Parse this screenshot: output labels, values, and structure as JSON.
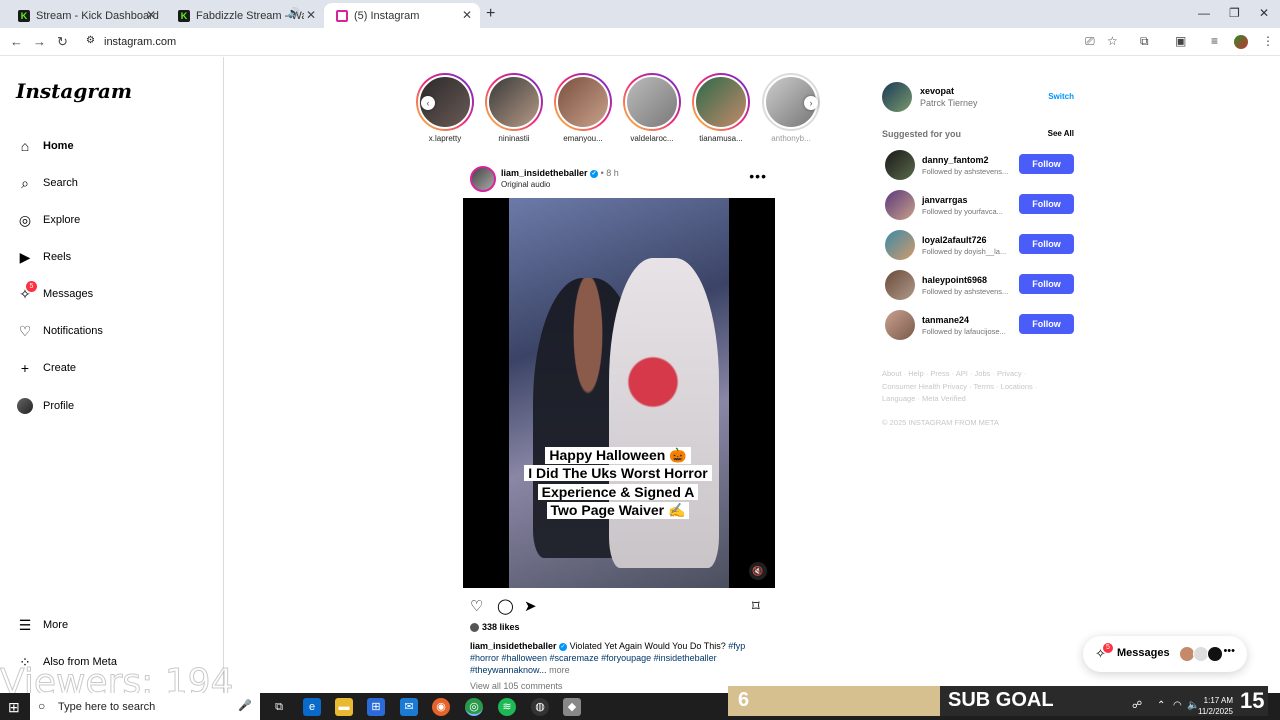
{
  "browser": {
    "tabs": [
      {
        "label": "Stream - Kick Dashboard",
        "favicon": "K"
      },
      {
        "label": "Fabdizzle Stream - Watch Li",
        "favicon": "K"
      },
      {
        "label": "(5) Instagram",
        "favicon": "instagram-icon"
      }
    ],
    "url": "instagram.com"
  },
  "sidebar": {
    "logo": "Instagram",
    "items": [
      {
        "label": "Home",
        "icon": "home-icon"
      },
      {
        "label": "Search",
        "icon": "search-icon"
      },
      {
        "label": "Explore",
        "icon": "compass-icon"
      },
      {
        "label": "Reels",
        "icon": "reels-icon"
      },
      {
        "label": "Messages",
        "icon": "messenger-icon",
        "badge": "5"
      },
      {
        "label": "Notifications",
        "icon": "heart-icon"
      },
      {
        "label": "Create",
        "icon": "plus-icon"
      },
      {
        "label": "Profile",
        "icon": "avatar"
      }
    ],
    "more": "More",
    "also_from_meta": "Also from Meta"
  },
  "stories": [
    {
      "name": "x.lapretty"
    },
    {
      "name": "nininastii"
    },
    {
      "name": "emanyou..."
    },
    {
      "name": "valdelaroc..."
    },
    {
      "name": "tianamusa..."
    },
    {
      "name": "anthonyb..."
    }
  ],
  "post": {
    "username": "liam_insidetheballer",
    "time": "8 h",
    "audio": "Original audio",
    "overlay_lines": [
      "Happy Halloween 🎃",
      "I Did The Uks Worst Horror",
      "Experience & Signed A",
      "Two Page Waiver ✍️"
    ],
    "likes": "338 likes",
    "caption_text": "Violated Yet Again Would You Do This?",
    "hashtags": "#fyp #horror #halloween #scaremaze #foryoupage #insidetheballer #theywannaknow...",
    "more": "more",
    "comments": "View all 105 comments"
  },
  "right": {
    "me_username": "xevopat",
    "me_name": "Patrck Tierney",
    "switch": "Switch",
    "suggested_title": "Suggested for you",
    "see_all": "See All",
    "follow_label": "Follow",
    "suggestions": [
      {
        "username": "danny_fantom2",
        "followed": "Followed by ashstevens..."
      },
      {
        "username": "janvarrgas",
        "followed": "Followed by yourfavca..."
      },
      {
        "username": "loyal2afault726",
        "followed": "Followed by doyish__la..."
      },
      {
        "username": "haleypoint6968",
        "followed": "Followed by ashstevens..."
      },
      {
        "username": "tanmane24",
        "followed": "Followed by lafaucijose..."
      }
    ],
    "footer": "About · Help · Press · API · Jobs · Privacy · Consumer Health Privacy · Terms · Locations · Language · Meta Verified",
    "copyright": "© 2025 INSTAGRAM FROM META"
  },
  "messages_pill": {
    "label": "Messages",
    "badge": "5"
  },
  "overlay": {
    "viewers": "Viewers: 194"
  },
  "subgoal": {
    "count": "6",
    "label": "SUB GOAL",
    "progress": 0.39
  },
  "taskbar": {
    "search_placeholder": "Type here to search",
    "time": "1:17 AM",
    "date": "11/2/2025",
    "big_number": "15"
  },
  "colors": {
    "accent": "#0095f6",
    "follow_button": "#4a5df9",
    "badge": "#ff3040"
  }
}
